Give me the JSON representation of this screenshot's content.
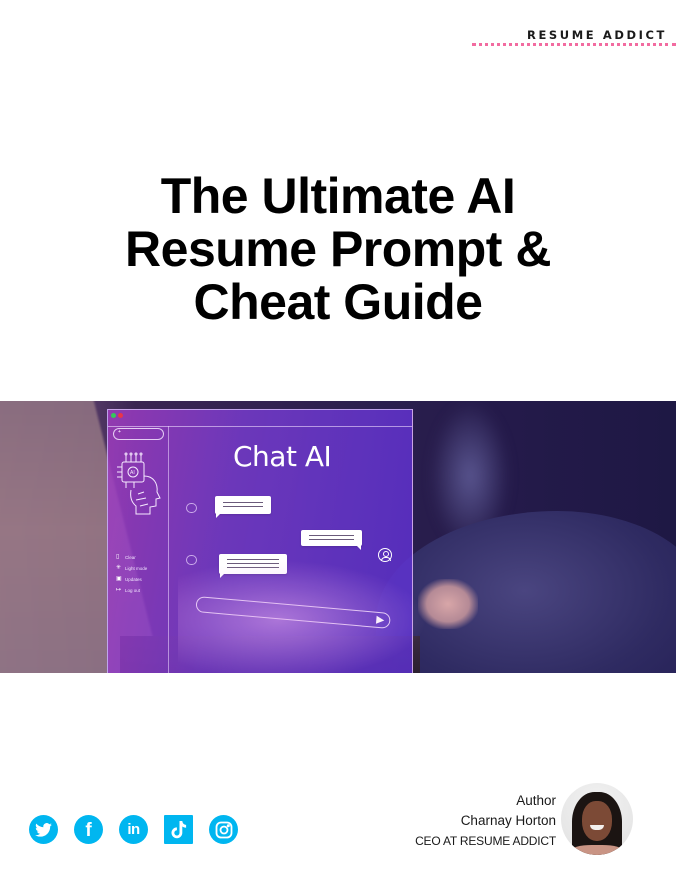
{
  "brand": {
    "name": "RESUME ADDICT",
    "accent_color": "#f26ba0"
  },
  "title": {
    "lines": [
      "The Ultimate AI",
      "Resume Prompt &",
      "Cheat Guide"
    ]
  },
  "hero": {
    "description": "Hands typing on a laptop with a holographic chat interface overlay",
    "screen": {
      "heading": "Chat AI",
      "search_symbol": "+",
      "menu": [
        {
          "icon": "trash-icon",
          "label": "Clear"
        },
        {
          "icon": "sun-icon",
          "label": "Light mode"
        },
        {
          "icon": "update-icon",
          "label": "Updates"
        },
        {
          "icon": "logout-icon",
          "label": "Log out"
        }
      ],
      "window_dots": [
        "#36c65c",
        "#e8354a"
      ]
    }
  },
  "socials": [
    {
      "name": "twitter",
      "label": "Twitter"
    },
    {
      "name": "facebook",
      "label": "f"
    },
    {
      "name": "linkedin",
      "label": "in"
    },
    {
      "name": "tiktok",
      "label": "TikTok"
    },
    {
      "name": "instagram",
      "label": "Instagram"
    }
  ],
  "social_color": "#00b6f0",
  "author": {
    "label": "Author",
    "name": "Charnay Horton",
    "role": "CEO AT RESUME ADDICT"
  }
}
